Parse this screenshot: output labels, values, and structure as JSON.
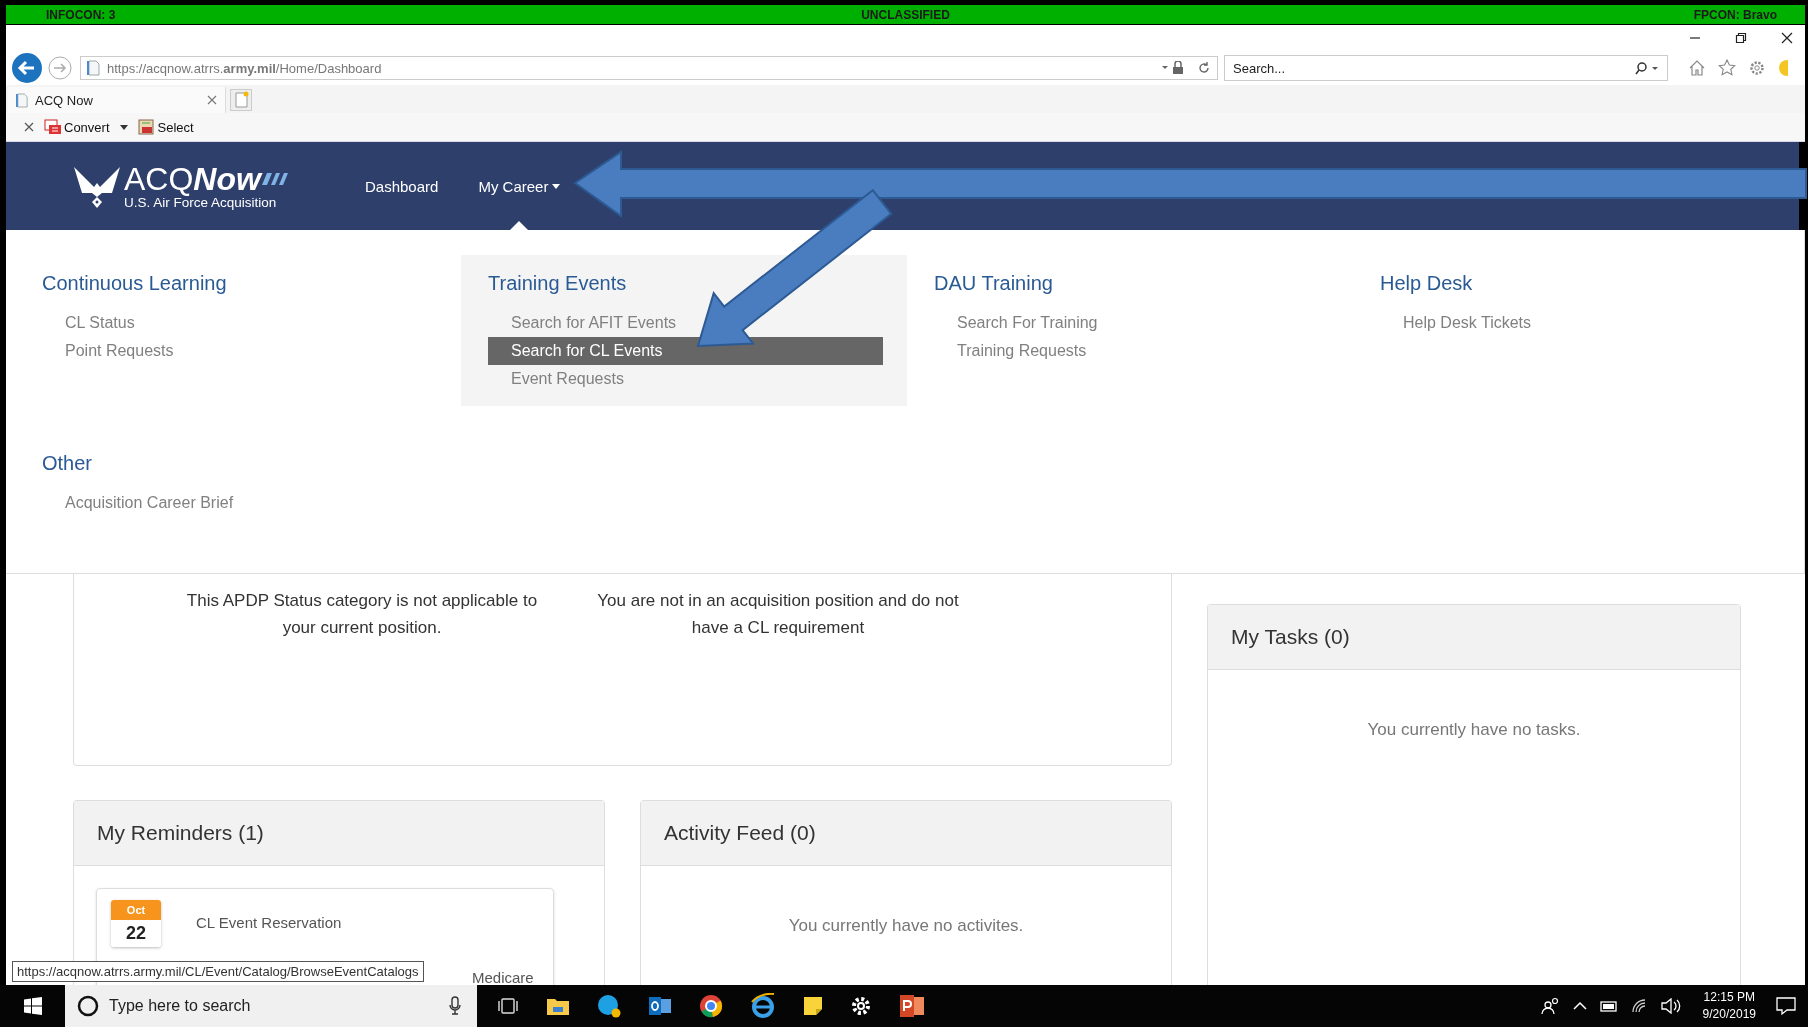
{
  "banner": {
    "left": "INFOCON: 3",
    "center": "UNCLASSIFIED",
    "right": "FPCON: Bravo"
  },
  "browser": {
    "url": "https://acqnow.atrrs.**army.mil**/Home/Dashboard",
    "search_placeholder": "Search...",
    "tabs": [
      {
        "label": "ACQ Now",
        "selected": true
      }
    ],
    "toolbar": [
      {
        "label": "Convert",
        "kind": "convert"
      },
      {
        "label": "Select",
        "kind": "select"
      }
    ]
  },
  "nav": {
    "brand": "ACQ",
    "brand_emph": "Now",
    "subtitle": "U.S. Air Force Acquisition",
    "links": [
      {
        "label": "Dashboard",
        "dropdown": false
      },
      {
        "label": "My Career",
        "dropdown": true
      }
    ]
  },
  "menu": [
    {
      "title": "Continuous Learning",
      "active": false,
      "items": [
        {
          "label": "CL Status",
          "selected": false
        },
        {
          "label": "Point Requests",
          "selected": false
        }
      ]
    },
    {
      "title": "Training Events",
      "active": true,
      "items": [
        {
          "label": "Search for AFIT Events",
          "selected": false
        },
        {
          "label": "Search for CL Events",
          "selected": true
        },
        {
          "label": "Event Requests",
          "selected": false
        }
      ]
    },
    {
      "title": "DAU Training",
      "active": false,
      "items": [
        {
          "label": "Search For Training",
          "selected": false
        },
        {
          "label": "Training Requests",
          "selected": false
        }
      ]
    },
    {
      "title": "Help Desk",
      "active": false,
      "items": [
        {
          "label": "Help Desk Tickets",
          "selected": false
        }
      ]
    },
    {
      "title": "Other",
      "active": false,
      "items": [
        {
          "label": "Acquisition Career Brief",
          "selected": false
        }
      ]
    }
  ],
  "status_panel": {
    "texts": [
      "This APDP Status category is not applicable to your current position.",
      "You are not in an acquisition position and do not have a CL requirement"
    ]
  },
  "reminders": {
    "title": "My Reminders (1)",
    "items": [
      {
        "month": "Oct",
        "day": "22",
        "title": "CL Event Reservation",
        "detail": "Medicare"
      }
    ]
  },
  "activity": {
    "title": "Activity Feed (0)",
    "empty": "You currently have no activites."
  },
  "tasks": {
    "title": "My Tasks (0)",
    "empty": "You currently have no tasks."
  },
  "status_tooltip": "https://acqnow.atrrs.army.mil/CL/Event/Catalog/BrowseEventCatalogs",
  "taskbar": {
    "search_placeholder": "Type here to search",
    "time": "12:15 PM",
    "date": "9/20/2019"
  }
}
